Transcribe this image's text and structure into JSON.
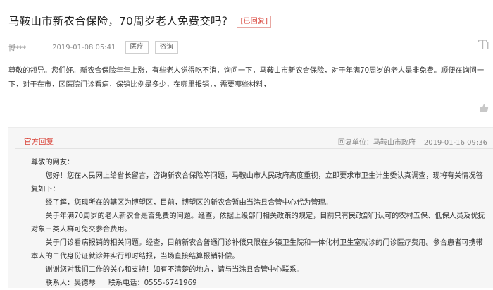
{
  "question": {
    "title": "马鞍山市新农合保险，70周岁老人免费交吗？",
    "status": "[已回复]",
    "author": "博***",
    "date": "2019-01-08 05:41",
    "tags": [
      "医疗",
      "咨询"
    ],
    "font_toggle": "T",
    "body": "尊敬的领导。您们好。新农合保险年年上涨，有些老人觉得吃不消，询问一下，马鞍山市新农合保险，对于年满70周岁的老人是非免费。顺便在询问一下，对于在市，区医院门诊看病，保销比例是多少，在哪里报销，，需要哪些材料，"
  },
  "reply": {
    "label": "官方回复",
    "unit_label": "回复单位：马鞍山市政府",
    "date": "2019-01-16 09:36",
    "greeting": "尊敬的网友：",
    "paragraphs": [
      "您好！您在人民网上给省长留言，咨询新农合保险等问题，马鞍山市人民政府高度重视，立即要求市卫生计生委认真调查，现将有关情况答复如下：",
      "经了解，您现所在的辖区为博望区，目前，博望区的新农合暂由当涂县合管中心代为管理。",
      "关于年满70周岁的老人新农合是否免费的问题。经查，依据上级部门相关政策的规定，目前只有民政部门认可的农村五保、低保人员及优抚对象三类人群可免交参合费用。",
      "关于门诊看病报销的相关问题。经查，目前新农合普通门诊补偿只限在乡镇卫生院和一体化村卫生室就诊的门诊医疗费用。参合患者可携带本人的二代身份证就诊并实行即时结报，当场直接结算报销补偿。",
      "谢谢您对我们工作的关心和支持！如有不清楚的地方，请与当涂县合管中心联系。"
    ],
    "contact_person": "联系人：吴德琴",
    "contact_phone": "联系电话：0555-6741969"
  },
  "colors": {
    "accent": "#d9463c",
    "reply_bg": "#f6f6f6",
    "muted": "#888888"
  },
  "icons": [
    "thumbs-up-icon"
  ]
}
